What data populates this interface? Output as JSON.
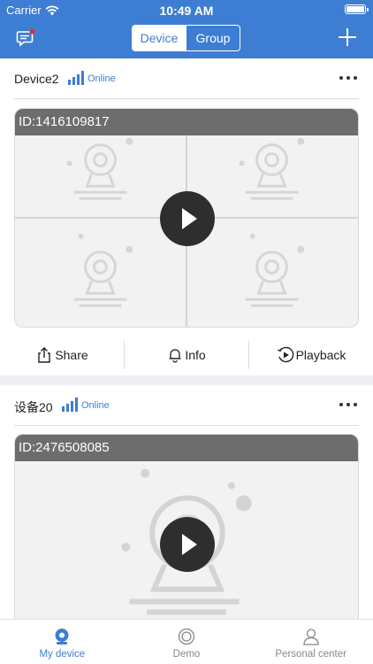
{
  "status_bar": {
    "carrier": "Carrier",
    "time": "10:49 AM"
  },
  "header": {
    "segment": {
      "options": [
        "Device",
        "Group"
      ],
      "selected": "Device"
    },
    "icons": {
      "left": "message-icon",
      "right": "plus-icon"
    }
  },
  "devices": [
    {
      "name": "Device2",
      "status": "Online",
      "id_label": "ID:1416109817",
      "layout": "quad"
    },
    {
      "name": "设备20",
      "status": "Online",
      "id_label": "ID:2476508085",
      "layout": "single"
    }
  ],
  "card_actions": {
    "share": "Share",
    "info": "Info",
    "playback": "Playback"
  },
  "tabs": [
    {
      "label": "My device",
      "icon": "camera-icon",
      "active": true
    },
    {
      "label": "Demo",
      "icon": "lens-icon",
      "active": false
    },
    {
      "label": "Personal center",
      "icon": "person-icon",
      "active": false
    }
  ],
  "colors": {
    "brand": "#3e7dd4",
    "badge": "#e0312f",
    "tab_inactive": "#888888"
  }
}
